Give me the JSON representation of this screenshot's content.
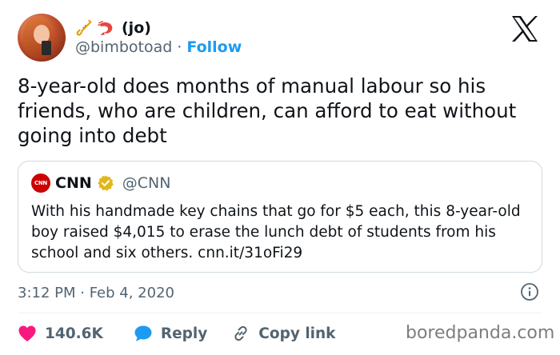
{
  "author": {
    "display_name": "(jo)",
    "handle": "@bimbotoad",
    "separator": "·",
    "follow_label": "Follow",
    "name_emojis": [
      "saxophone-icon",
      "shrimp-icon"
    ]
  },
  "tweet": {
    "text": "8-year-old does months of manual labour so his friends, who are children, can afford to eat without going into debt",
    "timestamp": "3:12 PM · Feb 4, 2020"
  },
  "quote": {
    "logo_text": "CNN",
    "name": "CNN",
    "handle": "@CNN",
    "text": "With his handmade key chains that go for $5 each, this 8-year-old boy raised $4,015 to erase the lunch debt of students from his school and six others. cnn.it/31oFi29"
  },
  "actions": {
    "like_count": "140.6K",
    "reply_label": "Reply",
    "copy_link_label": "Copy link"
  },
  "watermark": "boredpanda.com",
  "colors": {
    "accent": "#1d9bf0",
    "like": "#f91880",
    "verified": "#e2b719",
    "cnn_red": "#cc0000",
    "muted": "#536471"
  }
}
